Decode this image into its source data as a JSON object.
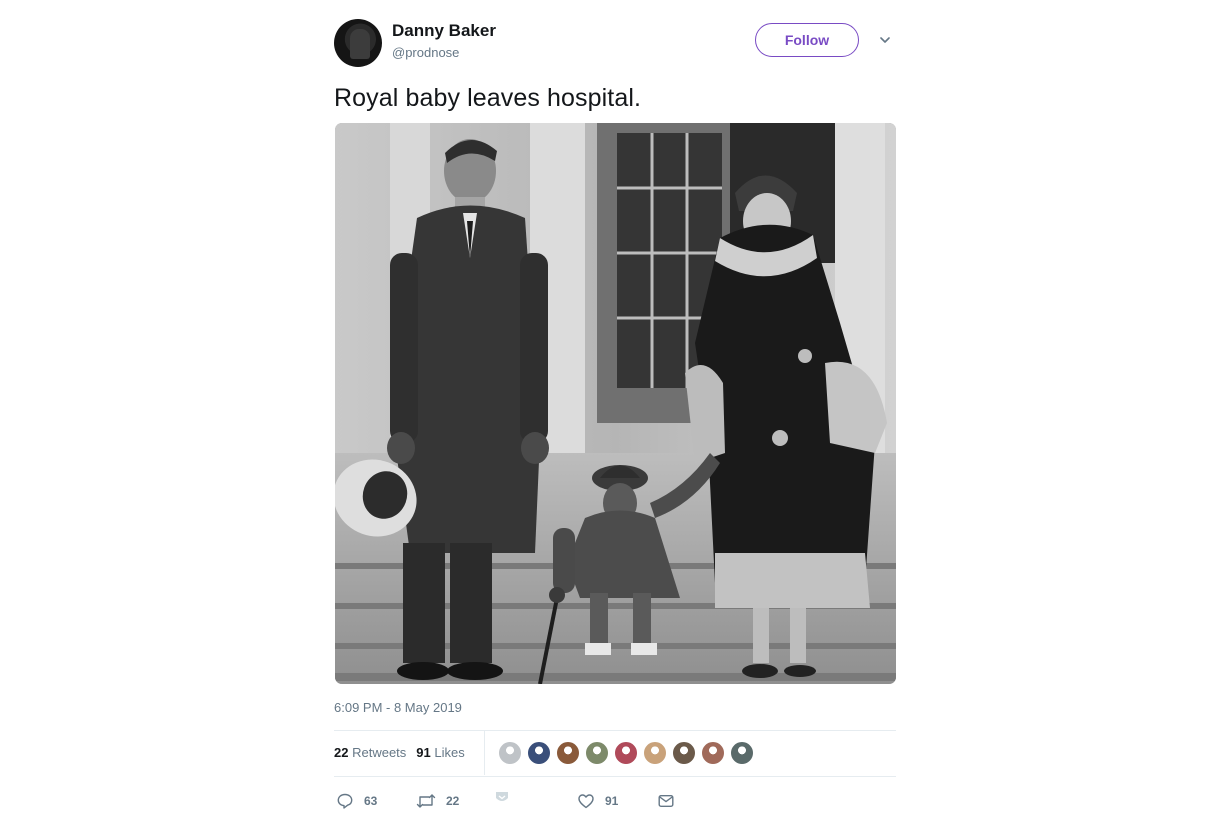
{
  "author": {
    "name": "Danny Baker",
    "handle": "@prodnose"
  },
  "follow_label": "Follow",
  "tweet_text": "Royal baby leaves hospital.",
  "timestamp": "6:09 PM - 8 May 2019",
  "stats": {
    "retweets_count": "22",
    "retweets_label": "Retweets",
    "likes_count": "91",
    "likes_label": "Likes"
  },
  "likers": [
    {
      "color": "#bfc3c7"
    },
    {
      "color": "#3a4f7a"
    },
    {
      "color": "#8a5a3a"
    },
    {
      "color": "#7d8a6a"
    },
    {
      "color": "#b04a5a"
    },
    {
      "color": "#c9a27a"
    },
    {
      "color": "#6b5a4a"
    },
    {
      "color": "#a06a5a"
    },
    {
      "color": "#5a6a6a"
    }
  ],
  "actions": {
    "reply_count": "63",
    "retweet_count": "22",
    "like_count": "91"
  },
  "icons": {
    "reply": "speech-bubble-icon",
    "retweet": "retweet-arrows-icon",
    "direct_message_shield": "shield-icon",
    "like": "heart-icon",
    "share": "envelope-icon",
    "caret": "chevron-down-icon"
  },
  "colors": {
    "accent": "#794bc4",
    "muted_text": "#657786",
    "primary_text": "#14171a",
    "divider": "#e6ecf0"
  }
}
